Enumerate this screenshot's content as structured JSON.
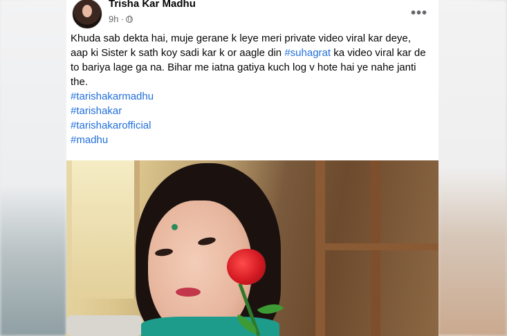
{
  "post": {
    "author_name": "Trisha Kar Madhu",
    "timestamp": "9h",
    "separator": "·",
    "audience_icon": "globe-icon",
    "more_icon": "more-options-icon",
    "more_glyph": "•••",
    "text_before_tag": "Khuda sab dekta hai, muje gerane k leye meri private video viral kar deye, aap ki Sister k sath koy sadi kar k or aagle din ",
    "inline_tag": "#suhagrat",
    "text_after_tag": " ka video viral kar de to bariya lage ga na. Bihar me iatna gatiya kuch log v hote hai ye nahe janti the.",
    "hashtags": [
      "#tarishakarmadhu",
      "#tarishakar",
      "#tarishakarofficial",
      "#madhu"
    ]
  },
  "colors": {
    "hashtag": "#216fdb",
    "name": "#050505",
    "meta": "#65676b"
  }
}
